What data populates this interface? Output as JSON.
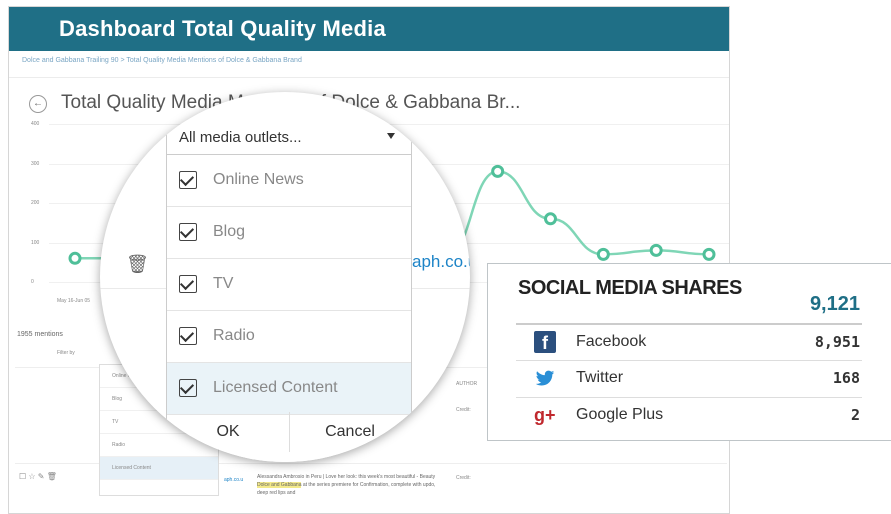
{
  "header": {
    "title": "Dashboard Total Quality Media"
  },
  "breadcrumb": "Dolce and Gabbana Trailing 90 > Total Quality Media Mentions of Dolce & Gabbana Brand",
  "chart": {
    "title": "Total Quality Media Mentions of Dolce & Gabbana Br...",
    "back_icon": "arrow-left-icon",
    "y_ticks": [
      "400",
      "300",
      "200",
      "100",
      "0"
    ],
    "x_first_label": "May 16-Jun 05",
    "line_color": "#7fd6b6",
    "point_color": "#4fbf99"
  },
  "chart_data": {
    "type": "line",
    "title": "Total Quality Media Mentions of Dolce & Gabbana Br...",
    "ylim": [
      0,
      400
    ],
    "y_ticks": [
      0,
      100,
      200,
      300,
      400
    ],
    "series": [
      {
        "values": [
          60,
          60,
          60,
          60,
          60,
          60,
          60,
          60,
          280,
          160,
          70,
          80,
          70
        ]
      }
    ]
  },
  "mentions": {
    "count_label": "1955 mentions",
    "filter_label": "Filter by",
    "author_label": "AUTHOR",
    "credit_label": "Credit:"
  },
  "mini_dropdown": {
    "items": [
      "Online News",
      "Blog",
      "TV",
      "Radio",
      "Licensed Content"
    ],
    "ok": "OK",
    "cancel": "Cancel"
  },
  "rows": [
    {
      "source": "aph.co.u",
      "text": "Alessandra Ambrosio in Peru | Love her look: this week's most beautiful - Beauty",
      "highlight": "Dolce and Gabbana",
      "rest": "at the series premiere for Confirmation, complete with updo, deep red lips and"
    }
  ],
  "magnifier": {
    "link_fragment": "aph.co.u",
    "dropdown": {
      "selected": "All media outlets...",
      "options": [
        "Online News",
        "Blog",
        "TV",
        "Radio",
        "Licensed Content"
      ],
      "ok": "OK",
      "cancel": "Cancel"
    }
  },
  "social": {
    "title": "SOCIAL MEDIA SHARES",
    "total": "9,121",
    "accent": "#1f6f86",
    "items": [
      {
        "name": "Facebook",
        "value": "8,951",
        "icon": "facebook-icon",
        "color": "#2b4f7e"
      },
      {
        "name": "Twitter",
        "value": "168",
        "icon": "twitter-icon",
        "color": "#2a8fd6"
      },
      {
        "name": "Google Plus",
        "value": "2",
        "icon": "google-plus-icon",
        "color": "#c0282d"
      }
    ]
  }
}
